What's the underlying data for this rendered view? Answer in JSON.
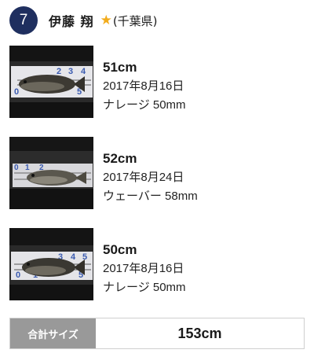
{
  "angler": {
    "rank": "7",
    "name": "伊藤 翔",
    "star": "★",
    "prefecture": "(千葉県)"
  },
  "catches": [
    {
      "size": "51cm",
      "date": "2017年8月16日",
      "lure": "ナレージ 50mm",
      "photo_icon": "fish-photo"
    },
    {
      "size": "52cm",
      "date": "2017年8月24日",
      "lure": "ウェーバー 58mm",
      "photo_icon": "fish-photo"
    },
    {
      "size": "50cm",
      "date": "2017年8月16日",
      "lure": "ナレージ 50mm",
      "photo_icon": "fish-photo"
    }
  ],
  "total": {
    "label": "合計サイズ",
    "value": "153cm"
  },
  "colors": {
    "badge": "#1f2f5f",
    "star": "#f2ac1c",
    "total_label_bg": "#999999"
  }
}
